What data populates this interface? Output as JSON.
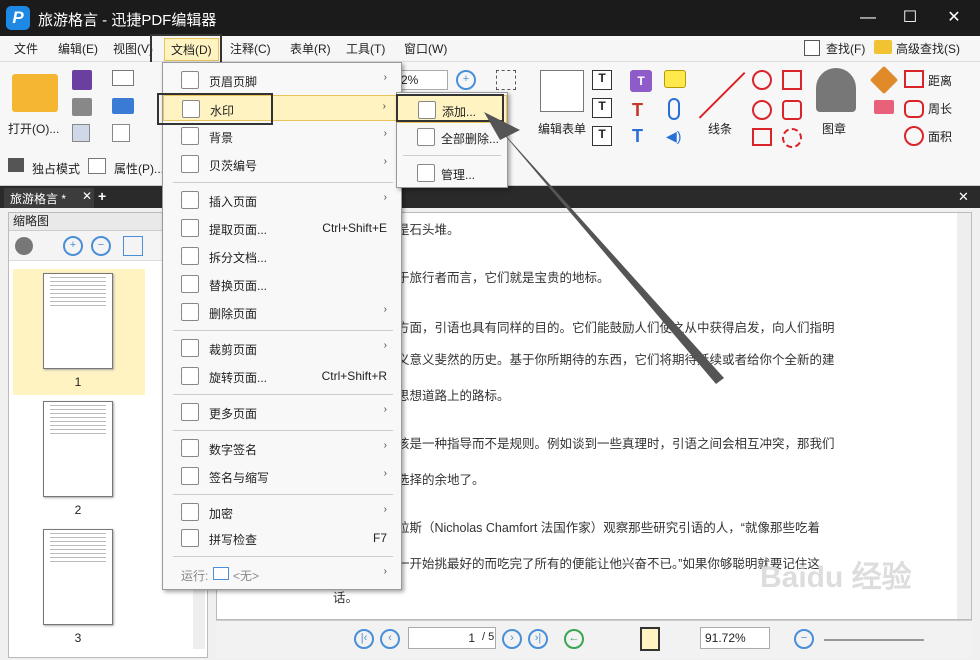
{
  "app": {
    "title": "旅游格言 - 迅捷PDF编辑器",
    "logo": "P"
  },
  "window": {
    "minimize": "—",
    "maximize": "☐",
    "close": "✕"
  },
  "menubar": {
    "items": [
      "文件",
      "编辑(E)",
      "视图(V)",
      "文档(D)",
      "注释(C)",
      "表单(R)",
      "工具(T)",
      "窗口(W)"
    ],
    "find": "查找(F)",
    "advanced_find": "高级查找(S)"
  },
  "toolbar": {
    "open": "打开(O)...",
    "exclusive": "独占模式",
    "properties": "属性(P)...",
    "zoom": "2%",
    "edit_form": "编辑表单",
    "line": "线条",
    "stamp": "图章",
    "distance": "距离",
    "perimeter": "周长",
    "area": "面积"
  },
  "tabs": {
    "doc_tab": "旅游格言 *",
    "add": "+"
  },
  "thumbs": {
    "header": "缩略图",
    "pages": [
      "1",
      "2",
      "3"
    ]
  },
  "document": {
    "lines": [
      "是石头堆。",
      "于旅行者而言，它们就是宝贵的地标。",
      "方面，引语也具有同样的目的。它们能鼓励人们使之从中获得启发，向人们指明",
      "义意义斐然的历史。基于你所期待的东西，它们将期待延续或者给你个全新的建",
      "思想道路上的路标。",
      "该是一种指导而不是规则。例如谈到一些真理时，引语之间会相互冲突，那我们",
      "选择的余地了。",
      "拉斯（Nicholas Chamfort 法国作家）观察那些研究引语的人，“就像那些吃着",
      "一开始挑最好的而吃完了所有的便能让他兴奋不已。”如果你够聪明就要记住这",
      "话。"
    ]
  },
  "status": {
    "page": "1",
    "page_total": "/ 5",
    "zoom": "91.72%"
  },
  "doc_menu": {
    "items": [
      {
        "label": "页眉页脚",
        "shortcut": "",
        "arrow": "›"
      },
      {
        "label": "水印",
        "shortcut": "",
        "arrow": "›"
      },
      {
        "label": "背景",
        "shortcut": "",
        "arrow": "›"
      },
      {
        "label": "贝茨编号",
        "shortcut": "",
        "arrow": "›"
      },
      {
        "label": "插入页面",
        "shortcut": "",
        "arrow": "›"
      },
      {
        "label": "提取页面...",
        "shortcut": "Ctrl+Shift+E",
        "arrow": ""
      },
      {
        "label": "拆分文档...",
        "shortcut": "",
        "arrow": ""
      },
      {
        "label": "替换页面...",
        "shortcut": "",
        "arrow": ""
      },
      {
        "label": "删除页面",
        "shortcut": "",
        "arrow": "›"
      },
      {
        "label": "裁剪页面",
        "shortcut": "",
        "arrow": "›"
      },
      {
        "label": "旋转页面...",
        "shortcut": "Ctrl+Shift+R",
        "arrow": ""
      },
      {
        "label": "更多页面",
        "shortcut": "",
        "arrow": "›"
      },
      {
        "label": "数字签名",
        "shortcut": "",
        "arrow": "›"
      },
      {
        "label": "签名与缩写",
        "shortcut": "",
        "arrow": "›"
      },
      {
        "label": "加密",
        "shortcut": "",
        "arrow": "›"
      },
      {
        "label": "拼写检查",
        "shortcut": "F7",
        "arrow": ""
      }
    ],
    "run_label": "运行:",
    "run_value": "<无>",
    "run_arrow": "›"
  },
  "watermark_submenu": {
    "items": [
      "添加...",
      "全部删除...",
      "管理..."
    ]
  },
  "overlay_watermark": "Baidu 经验",
  "colors": {
    "highlight": "#fff3c2",
    "titlebar": "#1b1b1b",
    "accent": "#1e88e5"
  }
}
